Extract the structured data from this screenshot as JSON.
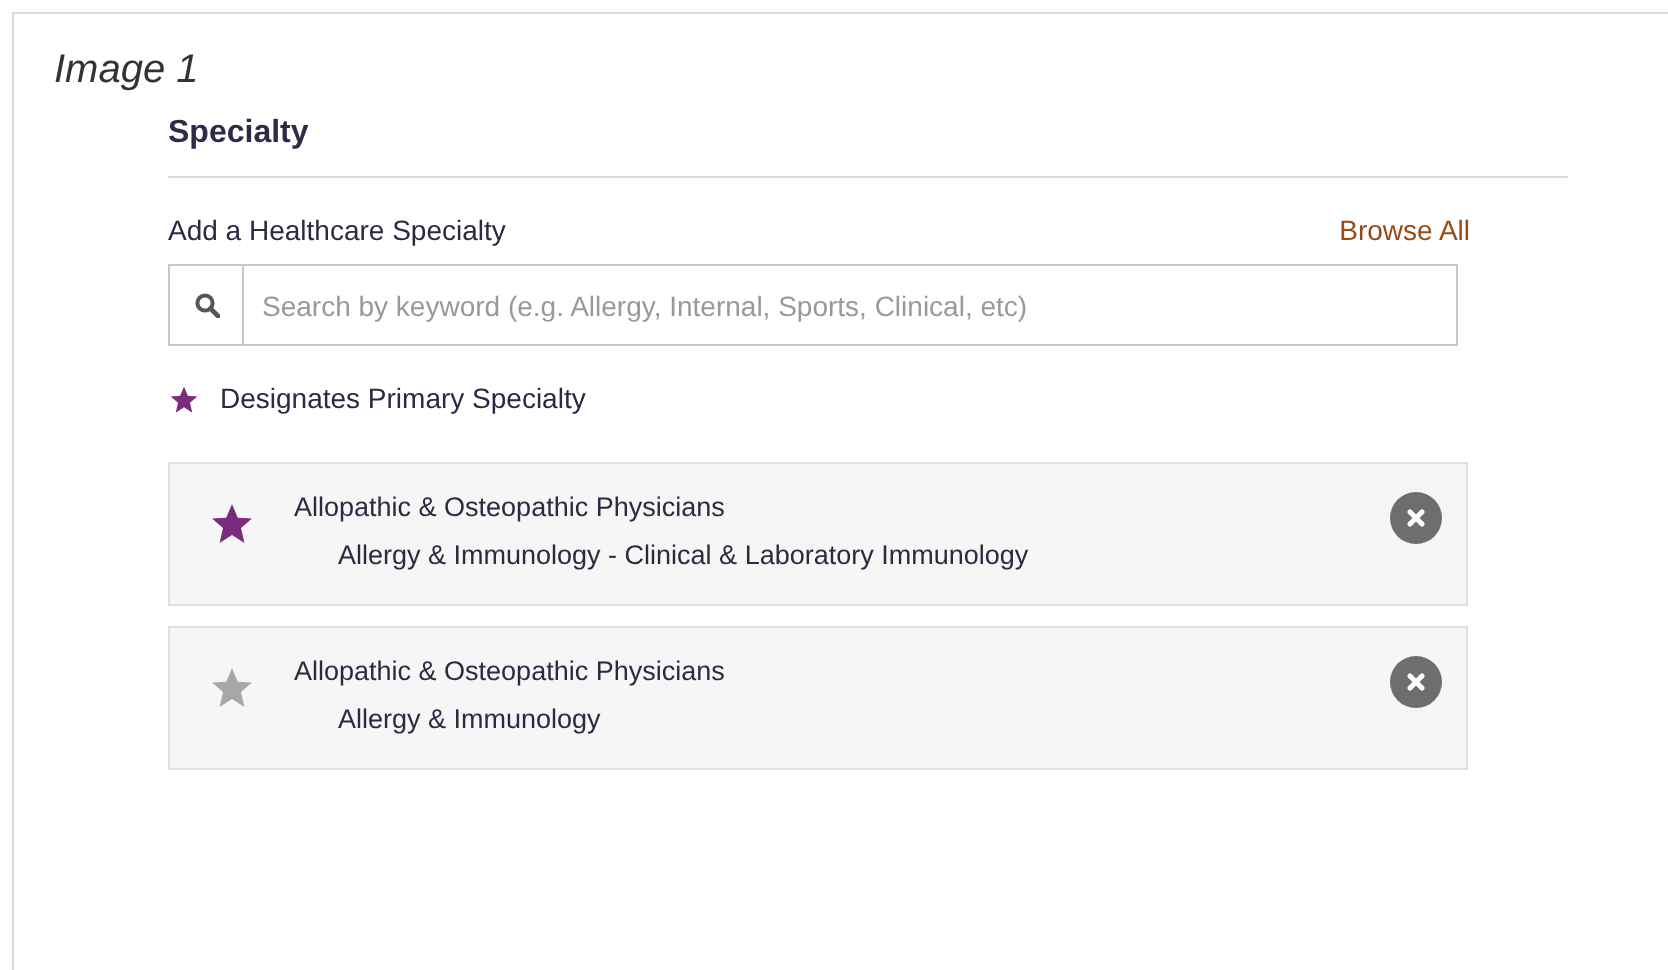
{
  "caption": "Image 1",
  "section": {
    "title": "Specialty",
    "add_label": "Add a Healthcare Specialty",
    "browse_link": "Browse All",
    "search": {
      "placeholder": "Search by keyword (e.g. Allergy, Internal, Sports, Clinical, etc)"
    },
    "legend": "Designates Primary Specialty",
    "specialties": [
      {
        "group": "Allopathic & Osteopathic Physicians",
        "name": "Allergy & Immunology - Clinical & Laboratory Immunology",
        "primary": true
      },
      {
        "group": "Allopathic & Osteopathic Physicians",
        "name": "Allergy & Immunology",
        "primary": false
      }
    ]
  }
}
